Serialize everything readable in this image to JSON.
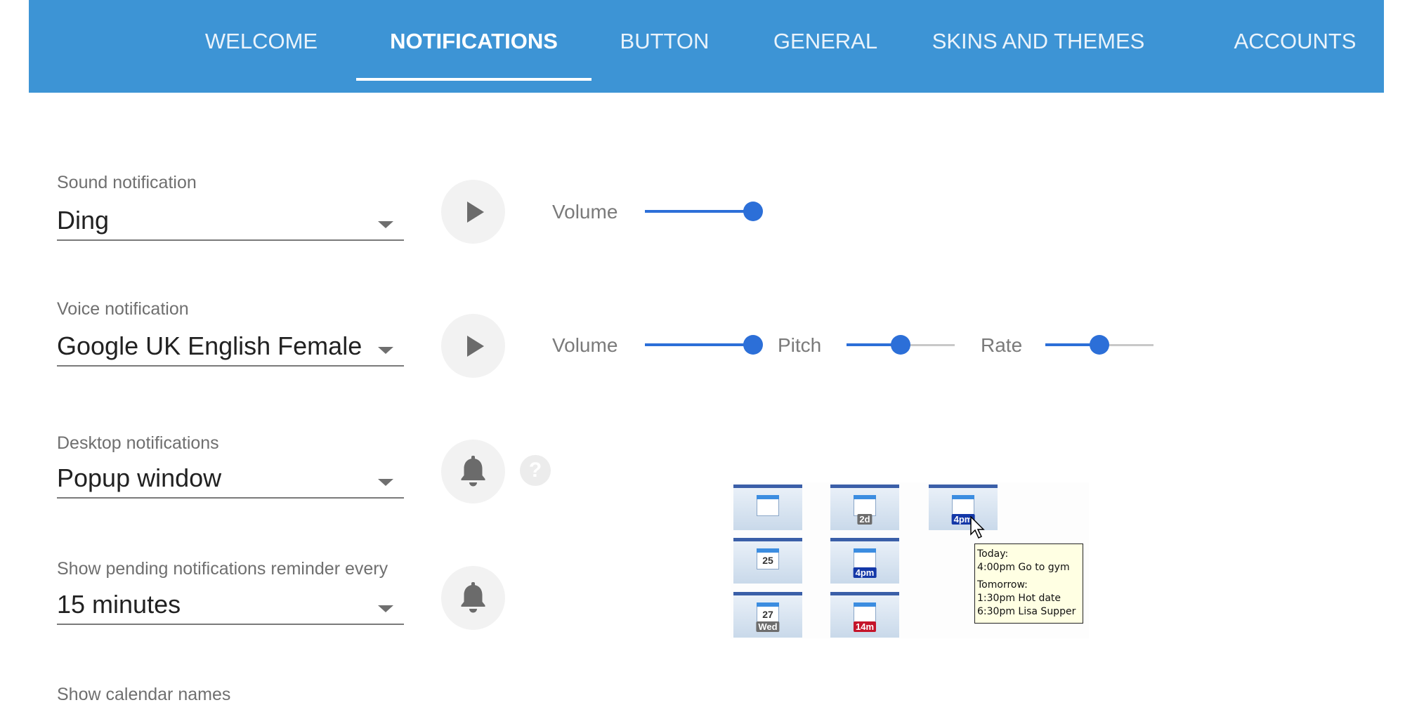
{
  "tabs": [
    {
      "label": "WELCOME",
      "active": false
    },
    {
      "label": "NOTIFICATIONS",
      "active": true
    },
    {
      "label": "BUTTON",
      "active": false
    },
    {
      "label": "GENERAL",
      "active": false
    },
    {
      "label": "SKINS AND THEMES",
      "active": false
    },
    {
      "label": "ACCOUNTS",
      "active": false
    }
  ],
  "sound": {
    "label": "Sound notification",
    "value": "Ding",
    "volume_label": "Volume",
    "volume": 1.0
  },
  "voice": {
    "label": "Voice notification",
    "value": "Google UK English Female",
    "volume_label": "Volume",
    "volume": 1.0,
    "pitch_label": "Pitch",
    "pitch": 0.5,
    "rate_label": "Rate",
    "rate": 0.5
  },
  "desktop": {
    "label": "Desktop notifications",
    "value": "Popup window",
    "help_glyph": "?"
  },
  "pending": {
    "label": "Show pending notifications reminder every",
    "value": "15 minutes"
  },
  "calendar_names": {
    "label": "Show calendar names"
  },
  "preview": {
    "icons": [
      {
        "number": "",
        "badge": ""
      },
      {
        "number": "",
        "badge": "2d"
      },
      {
        "number": "",
        "badge": "4pm"
      },
      {
        "number": "25",
        "badge": ""
      },
      {
        "number": "",
        "badge": "4pm"
      },
      {
        "number": "27",
        "badge": "Wed"
      },
      {
        "number": "",
        "badge": "14m"
      }
    ],
    "tooltip": {
      "line1": "Today:",
      "line2": "4:00pm Go to gym",
      "line3": "Tomorrow:",
      "line4": "1:30pm Hot date",
      "line5": "6:30pm Lisa Supper"
    }
  },
  "colors": {
    "header": "#3d94d5",
    "accent": "#2c6fd8"
  },
  "icons": {
    "play": "play-icon",
    "bell": "bell-icon",
    "help": "help-icon",
    "calendar": "calendar-icon",
    "cursor": "mouse-pointer-icon"
  }
}
